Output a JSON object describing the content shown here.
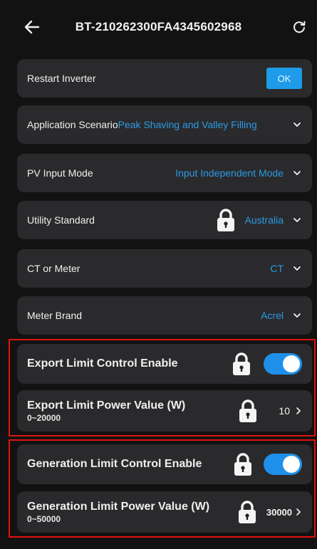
{
  "header": {
    "title": "BT-210262300FA4345602968",
    "back_icon": "arrow-left-icon",
    "refresh_icon": "refresh-icon"
  },
  "settings": {
    "restart": {
      "label": "Restart Inverter",
      "button": "OK"
    },
    "scenario": {
      "label": "Application Scenario",
      "value": "Peak Shaving and Valley Filling"
    },
    "pv_mode": {
      "label": "PV Input Mode",
      "value": "Input Independent Mode"
    },
    "utility": {
      "label": "Utility Standard",
      "value": "Australia",
      "locked": true
    },
    "ct_meter": {
      "label": "CT or Meter",
      "value": "CT"
    },
    "meter_brand": {
      "label": "Meter Brand",
      "value": "Acrel"
    },
    "export_enable": {
      "label": "Export Limit Control Enable",
      "enabled": true,
      "locked": true
    },
    "export_power": {
      "label": "Export Limit Power Value (W)",
      "range": "0~20000",
      "value": "10",
      "locked": true
    },
    "gen_enable": {
      "label": "Generation Limit Control Enable",
      "enabled": true,
      "locked": true
    },
    "gen_power": {
      "label": "Generation Limit Power Value (W)",
      "range": "0~50000",
      "value": "30000",
      "locked": true
    }
  },
  "colors": {
    "background": "#121212",
    "card": "#2a2a2c",
    "accent": "#1e9be9",
    "highlight_box": "#e0120f"
  }
}
